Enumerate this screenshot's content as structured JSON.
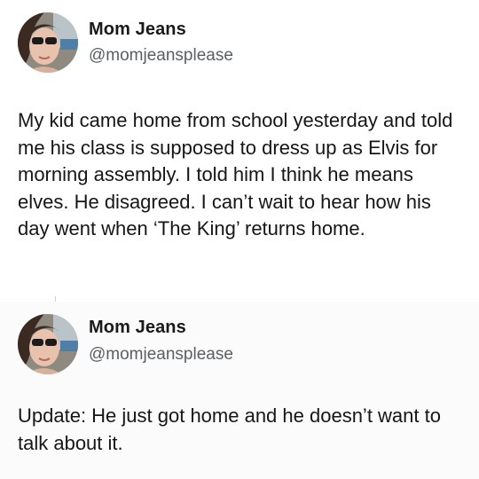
{
  "posts": [
    {
      "display_name": "Mom Jeans",
      "handle": "@momjeansplease",
      "text": "My kid came home from school yesterday and told me his class is supposed to dress up as Elvis for morning assembly. I told him I think he means elves. He disagreed. I can’t wait to hear how his day went when ‘The King’ returns home."
    },
    {
      "display_name": "Mom Jeans",
      "handle": "@momjeansplease",
      "text": "Update: He just got home and he doesn’t want to talk about it."
    }
  ],
  "colors": {
    "name": "#1a1a1a",
    "handle": "#5a5f63",
    "body": "#161616"
  }
}
